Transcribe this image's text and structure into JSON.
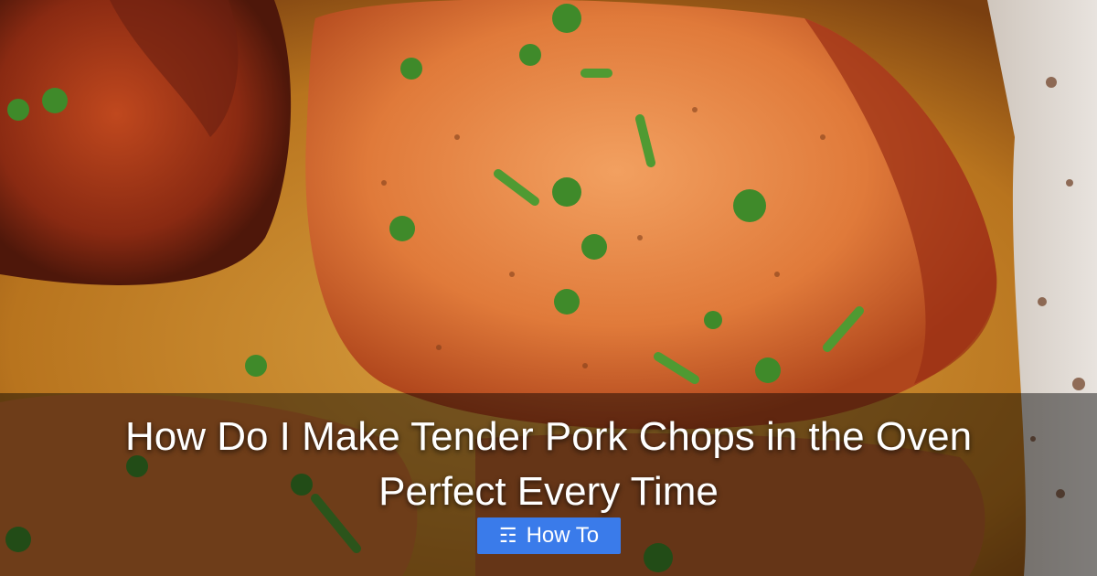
{
  "banner": {
    "title_line1": "How Do I Make Tender Pork Chops in the Oven",
    "title_line2": "Perfect Every Time",
    "badge_label": "How To",
    "badge_icon": "book-icon",
    "badge_color": "#3a7bea"
  }
}
